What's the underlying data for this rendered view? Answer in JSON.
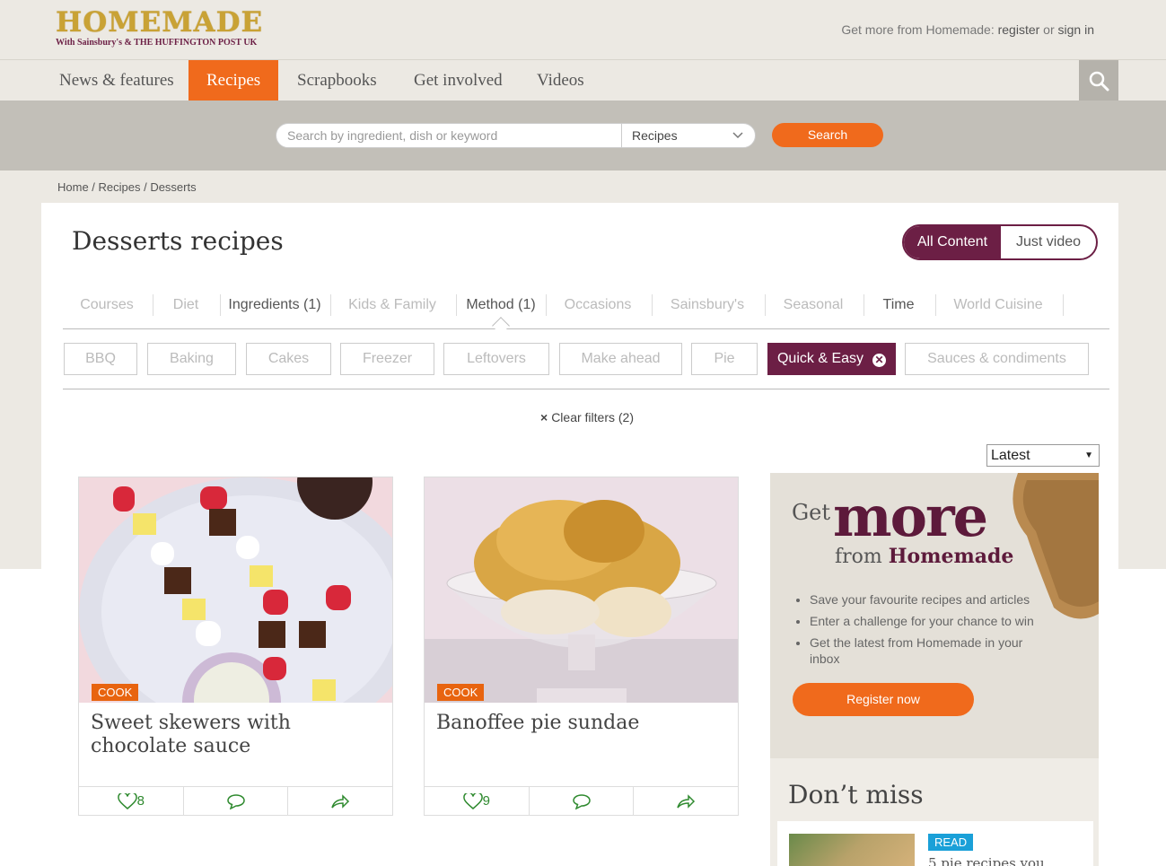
{
  "header": {
    "logo_main": "HOMEMADE",
    "logo_sub": "With Sainsbury's & THE HUFFINGTON POST UK",
    "account_prefix": "Get more from Homemade: ",
    "register": "register",
    "or": " or ",
    "signin": "sign in"
  },
  "nav": {
    "items": [
      "News & features",
      "Recipes",
      "Scrapbooks",
      "Get involved",
      "Videos"
    ],
    "active": "Recipes"
  },
  "search": {
    "placeholder": "Search by ingredient, dish or keyword",
    "scope": "Recipes",
    "button": "Search"
  },
  "breadcrumb": "Home / Recipes / Desserts",
  "page": {
    "title": "Desserts recipes",
    "toggle_on": "All Content",
    "toggle_off": "Just video"
  },
  "filter_tabs": [
    "Courses",
    "Diet",
    "Ingredients (1)",
    "Kids & Family",
    "Method (1)",
    "Occasions",
    "Sainsbury's",
    "Seasonal",
    "Time",
    "World Cuisine"
  ],
  "chips": [
    "BBQ",
    "Baking",
    "Cakes",
    "Freezer",
    "Leftovers",
    "Make ahead",
    "Pie",
    "Quick & Easy",
    "Sauces & condiments"
  ],
  "clear_filters": "Clear filters (2)",
  "sort": "Latest",
  "cards": [
    {
      "tag": "COOK",
      "title": "Sweet skewers with chocolate sauce",
      "likes": "8"
    },
    {
      "tag": "COOK",
      "title": "Banoffee pie sundae",
      "likes": "9"
    }
  ],
  "promo": {
    "get": "Get",
    "more": "more",
    "from": "from ",
    "brand": "Homemade",
    "bullets": [
      "Save your favourite recipes and articles",
      "Enter a challenge for your chance to win",
      "Get the latest from Homemade in your inbox"
    ],
    "button": "Register now"
  },
  "dont_miss": {
    "title": "Don’t miss",
    "tag": "READ",
    "text": "5 pie recipes you"
  },
  "colors": {
    "accent": "#f06a1c",
    "brand": "#6c1f45",
    "icon_green": "#2f8a2f"
  }
}
